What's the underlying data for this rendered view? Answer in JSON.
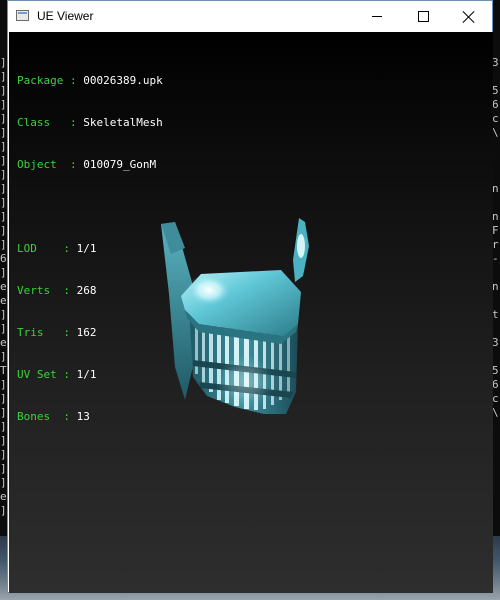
{
  "window": {
    "title": "UE Viewer"
  },
  "info": {
    "package_label": "Package : ",
    "package_value": "00026389.upk",
    "class_label": "Class   : ",
    "class_value": "SkeletalMesh",
    "object_label": "Object  : ",
    "object_value": "010079_GonM",
    "lod_label": "LOD    : ",
    "lod_value": "1/1",
    "verts_label": "Verts  : ",
    "verts_value": "268",
    "tris_label": "Tris   : ",
    "tris_value": "162",
    "uvset_label": "UV Set : ",
    "uvset_value": "1/1",
    "bones_label": "Bones  : ",
    "bones_value": "13"
  },
  "colors": {
    "label": "#3cd23c",
    "value": "#ffffff",
    "mesh": "#4fb8c8"
  },
  "icons": {
    "app": "app-icon",
    "minimize": "minimize-icon",
    "maximize": "maximize-icon",
    "close": "close-icon"
  }
}
